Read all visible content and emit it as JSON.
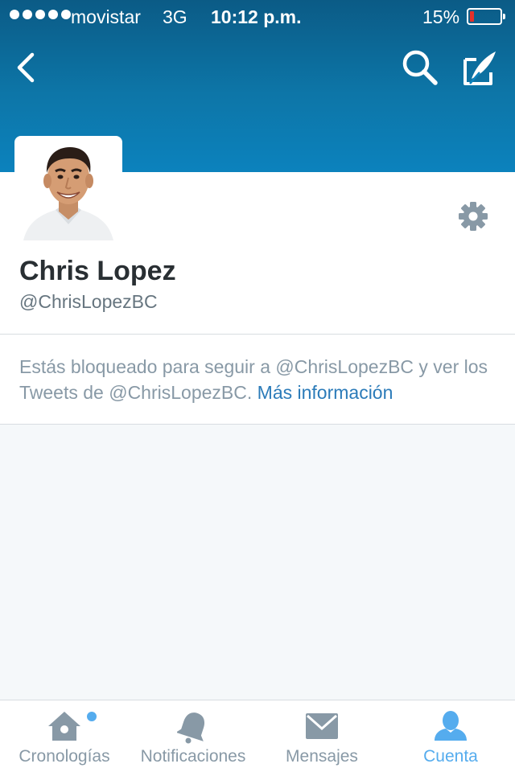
{
  "status_bar": {
    "carrier": "movistar",
    "network": "3G",
    "time": "10:12 p.m.",
    "battery": "15%",
    "battery_level": 0.15
  },
  "header": {
    "back_icon": "chevron-left-icon",
    "search_icon": "search-icon",
    "compose_icon": "compose-icon"
  },
  "profile": {
    "name": "Chris Lopez",
    "handle": "@ChrisLopezBC",
    "settings_icon": "gear-icon"
  },
  "blocked_notice": {
    "text": "Estás bloqueado para seguir a @ChrisLopezBC y ver los Tweets de @ChrisLopezBC.",
    "link": "Más información"
  },
  "tabbar": {
    "tabs": [
      {
        "label": "Cronologías",
        "icon": "home-icon",
        "active": false,
        "notification_dot": true
      },
      {
        "label": "Notificaciones",
        "icon": "bell-icon",
        "active": false
      },
      {
        "label": "Mensajes",
        "icon": "envelope-icon",
        "active": false
      },
      {
        "label": "Cuenta",
        "icon": "person-icon",
        "active": true
      }
    ]
  },
  "colors": {
    "header": "#0c76ab",
    "accent": "#55acee",
    "link": "#2b7bb9",
    "inactive_tab": "#8899a6"
  }
}
